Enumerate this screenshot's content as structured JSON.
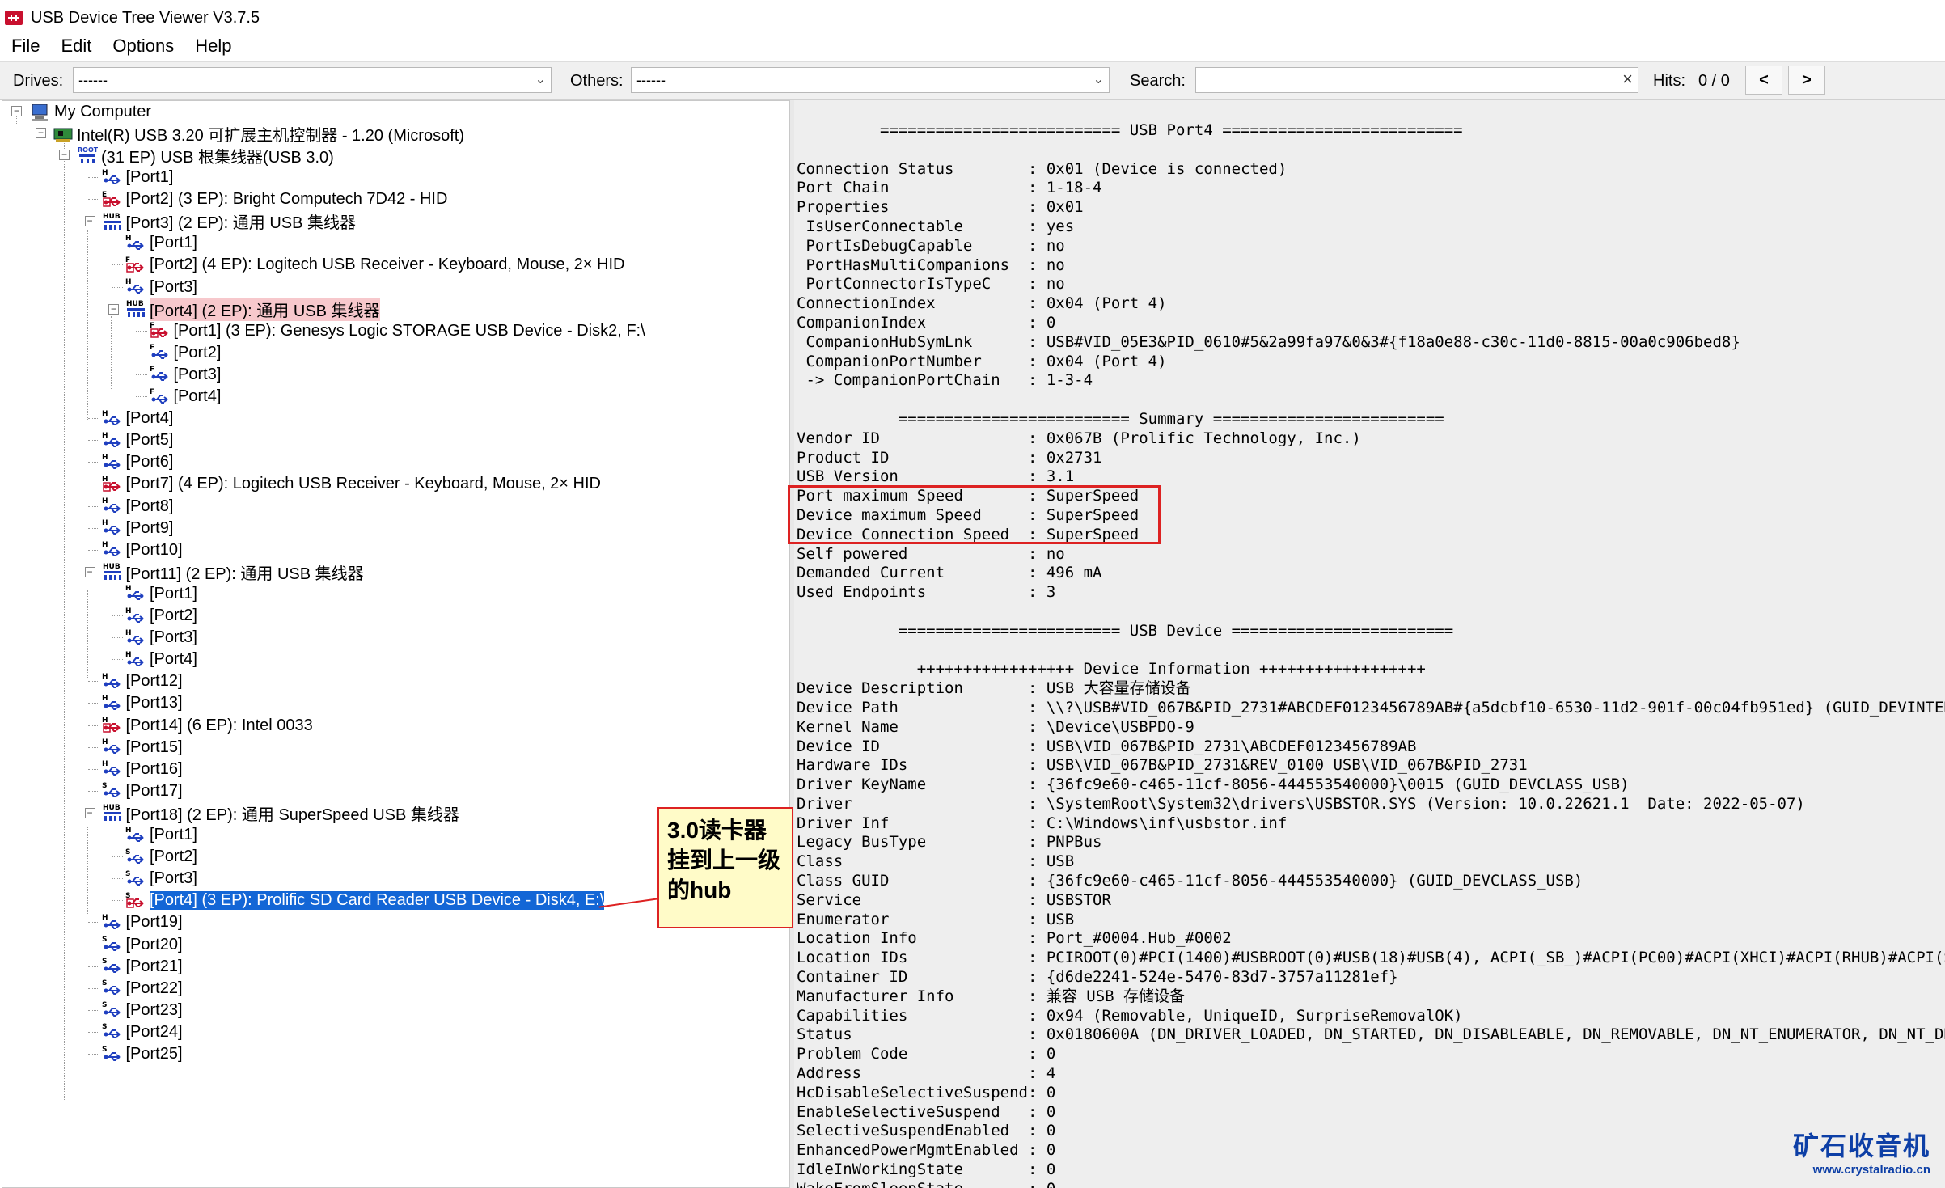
{
  "window": {
    "title": "USB Device Tree Viewer V3.7.5"
  },
  "menu": [
    "File",
    "Edit",
    "Options",
    "Help"
  ],
  "toolbar": {
    "drives_label": "Drives:",
    "drives_value": "------",
    "others_label": "Others:",
    "others_value": "------",
    "search_label": "Search:",
    "search_value": "",
    "hits_label": "Hits:",
    "hits_value": "0 / 0",
    "prev_label": "<",
    "next_label": ">"
  },
  "tree": {
    "root": "My Computer",
    "controller": "Intel(R) USB 3.20 可扩展主机控制器 - 1.20 (Microsoft)",
    "root_hub": "(31 EP) USB 根集线器(USB 3.0)",
    "nodes": [
      {
        "text": "[Port1]",
        "icon": "port",
        "letter": "H"
      },
      {
        "text": "[Port2] (3 EP): Bright Computech 7D42 - HID",
        "icon": "device",
        "letter": "E"
      },
      {
        "text": "[Port3] (2 EP): 通用 USB 集线器",
        "icon": "hub",
        "letter": "HUB"
      },
      {
        "text": "[Port1]",
        "icon": "port",
        "letter": "H"
      },
      {
        "text": "[Port2] (4 EP): Logitech USB Receiver - Keyboard, Mouse, 2× HID",
        "icon": "device",
        "letter": "F"
      },
      {
        "text": "[Port3]",
        "icon": "port",
        "letter": "H"
      },
      {
        "text": "[Port4] (2 EP): 通用 USB 集线器",
        "icon": "hub",
        "letter": "HUB"
      },
      {
        "text": "[Port1] (3 EP): Genesys Logic STORAGE USB Device - Disk2, F:\\",
        "icon": "device",
        "letter": "F"
      },
      {
        "text": "[Port2]",
        "icon": "port",
        "letter": "F"
      },
      {
        "text": "[Port3]",
        "icon": "port",
        "letter": "F"
      },
      {
        "text": "[Port4]",
        "icon": "port",
        "letter": "F"
      },
      {
        "text": "[Port4]",
        "icon": "port",
        "letter": "H"
      },
      {
        "text": "[Port5]",
        "icon": "port",
        "letter": "H"
      },
      {
        "text": "[Port6]",
        "icon": "port",
        "letter": "H"
      },
      {
        "text": "[Port7] (4 EP): Logitech USB Receiver - Keyboard, Mouse, 2× HID",
        "icon": "device",
        "letter": "H"
      },
      {
        "text": "[Port8]",
        "icon": "port",
        "letter": "H"
      },
      {
        "text": "[Port9]",
        "icon": "port",
        "letter": "H"
      },
      {
        "text": "[Port10]",
        "icon": "port",
        "letter": "H"
      },
      {
        "text": "[Port11] (2 EP): 通用 USB 集线器",
        "icon": "hub",
        "letter": "HUB"
      },
      {
        "text": "[Port1]",
        "icon": "port",
        "letter": "H"
      },
      {
        "text": "[Port2]",
        "icon": "port",
        "letter": "H"
      },
      {
        "text": "[Port3]",
        "icon": "port",
        "letter": "H"
      },
      {
        "text": "[Port4]",
        "icon": "port",
        "letter": "H"
      },
      {
        "text": "[Port12]",
        "icon": "port",
        "letter": "H"
      },
      {
        "text": "[Port13]",
        "icon": "port",
        "letter": "H"
      },
      {
        "text": "[Port14] (6 EP): Intel 0033",
        "icon": "device",
        "letter": "H"
      },
      {
        "text": "[Port15]",
        "icon": "port",
        "letter": "H"
      },
      {
        "text": "[Port16]",
        "icon": "port",
        "letter": "H"
      },
      {
        "text": "[Port17]",
        "icon": "port",
        "letter": "S"
      },
      {
        "text": "[Port18] (2 EP): 通用 SuperSpeed USB 集线器",
        "icon": "hub",
        "letter": "HUB"
      },
      {
        "text": "[Port1]",
        "icon": "port",
        "letter": "H"
      },
      {
        "text": "[Port2]",
        "icon": "port",
        "letter": "S"
      },
      {
        "text": "[Port3]",
        "icon": "port",
        "letter": "S"
      },
      {
        "text": "[Port4] (3 EP): Prolific SD Card Reader USB Device - Disk4, E:\\",
        "icon": "device",
        "letter": "S"
      },
      {
        "text": "[Port19]",
        "icon": "port",
        "letter": "H"
      },
      {
        "text": "[Port20]",
        "icon": "port",
        "letter": "S"
      },
      {
        "text": "[Port21]",
        "icon": "port",
        "letter": "S"
      },
      {
        "text": "[Port22]",
        "icon": "port",
        "letter": "S"
      },
      {
        "text": "[Port23]",
        "icon": "port",
        "letter": "S"
      },
      {
        "text": "[Port24]",
        "icon": "port",
        "letter": "S"
      },
      {
        "text": "[Port25]",
        "icon": "port",
        "letter": "S"
      }
    ]
  },
  "details": {
    "text": "         ========================== USB Port4 ==========================\n\nConnection Status        : 0x01 (Device is connected)\nPort Chain               : 1-18-4\nProperties               : 0x01\n IsUserConnectable       : yes\n PortIsDebugCapable      : no\n PortHasMultiCompanions  : no\n PortConnectorIsTypeC    : no\nConnectionIndex          : 0x04 (Port 4)\nCompanionIndex           : 0\n CompanionHubSymLnk      : USB#VID_05E3&PID_0610#5&2a99fa97&0&3#{f18a0e88-c30c-11d0-8815-00a0c906bed8}\n CompanionPortNumber     : 0x04 (Port 4)\n -> CompanionPortChain   : 1-3-4\n\n           ========================= Summary =========================\nVendor ID                : 0x067B (Prolific Technology, Inc.)\nProduct ID               : 0x2731\nUSB Version              : 3.1\nPort maximum Speed       : SuperSpeed\nDevice maximum Speed     : SuperSpeed\nDevice Connection Speed  : SuperSpeed\nSelf powered             : no\nDemanded Current         : 496 mA\nUsed Endpoints           : 3\n\n           ======================== USB Device ========================\n\n             +++++++++++++++++ Device Information ++++++++++++++++++\nDevice Description       : USB 大容量存储设备\nDevice Path              : \\\\?\\USB#VID_067B&PID_2731#ABCDEF0123456789AB#{a5dcbf10-6530-11d2-901f-00c04fb951ed} (GUID_DEVINTERFACE\nKernel Name              : \\Device\\USBPDO-9\nDevice ID                : USB\\VID_067B&PID_2731\\ABCDEF0123456789AB\nHardware IDs             : USB\\VID_067B&PID_2731&REV_0100 USB\\VID_067B&PID_2731\nDriver KeyName           : {36fc9e60-c465-11cf-8056-444553540000}\\0015 (GUID_DEVCLASS_USB)\nDriver                   : \\SystemRoot\\System32\\drivers\\USBSTOR.SYS (Version: 10.0.22621.1  Date: 2022-05-07)\nDriver Inf               : C:\\Windows\\inf\\usbstor.inf\nLegacy BusType           : PNPBus\nClass                    : USB\nClass GUID               : {36fc9e60-c465-11cf-8056-444553540000} (GUID_DEVCLASS_USB)\nService                  : USBSTOR\nEnumerator               : USB\nLocation Info            : Port_#0004.Hub_#0002\nLocation IDs             : PCIROOT(0)#PCI(1400)#USBROOT(0)#USB(18)#USB(4), ACPI(_SB_)#ACPI(PC00)#ACPI(XHCI)#ACPI(RHUB)#ACPI(SS02)\nContainer ID             : {d6de2241-524e-5470-83d7-3757a11281ef}\nManufacturer Info        : 兼容 USB 存储设备\nCapabilities             : 0x94 (Removable, UniqueID, SurpriseRemovalOK)\nStatus                   : 0x0180600A (DN_DRIVER_LOADED, DN_STARTED, DN_DISABLEABLE, DN_REMOVABLE, DN_NT_ENUMERATOR, DN_NT_DRIVER\nProblem Code             : 0\nAddress                  : 4\nHcDisableSelectiveSuspend: 0\nEnableSelectiveSuspend   : 0\nSelectiveSuspendEnabled  : 0\nEnhancedPowerMgmtEnabled : 0\nIdleInWorkingState       : 0\nWakeFromSleepState       : 0"
  },
  "annotation": {
    "callout_text": "3.0读卡器挂到上一级的hub"
  },
  "watermark": {
    "main": "矿石收音机",
    "sub": "www.crystalradio.cn"
  },
  "colors": {
    "selection": "#1366d6",
    "highlight": "#f7c8cc",
    "annotation": "#dd2222",
    "callout_bg": "#fffbc8",
    "watermark": "#0d3fa6"
  }
}
